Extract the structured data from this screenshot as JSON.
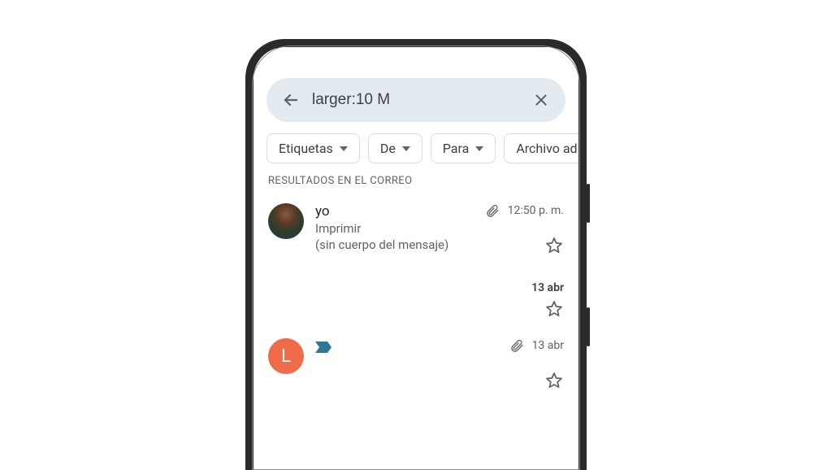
{
  "search": {
    "query": "larger:10 M"
  },
  "filters": [
    {
      "label": "Etiquetas"
    },
    {
      "label": "De"
    },
    {
      "label": "Para"
    },
    {
      "label": "Archivo ad"
    }
  ],
  "section_header": "RESULTADOS EN EL CORREO",
  "emails": [
    {
      "avatar": {
        "type": "photo"
      },
      "sender": "yo",
      "subject": "Imprimir",
      "snippet": "(sin cuerpo del mensaje)",
      "has_attachment": true,
      "time": "12:50 p. m.",
      "starred": false
    },
    {
      "avatar": {
        "type": "blank"
      },
      "sender": "",
      "subject": "",
      "snippet": "",
      "has_attachment": false,
      "time": "13 abr",
      "starred": false
    },
    {
      "avatar": {
        "type": "letter",
        "letter": "L",
        "color": "#ef6c4a"
      },
      "has_label_bookmark": true,
      "sender": "",
      "subject": "",
      "snippet": "",
      "has_attachment": true,
      "time": "13 abr",
      "starred": false
    }
  ]
}
